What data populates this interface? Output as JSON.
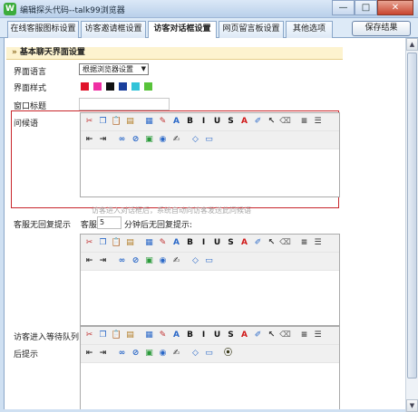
{
  "window": {
    "title": "编辑探头代码--talk99浏览器",
    "minimize": "—",
    "maximize": "□",
    "close": "✕"
  },
  "tabs": [
    {
      "label": "在线客服图标设置"
    },
    {
      "label": "访客邀请框设置"
    },
    {
      "label": "访客对话框设置",
      "active": true
    },
    {
      "label": "网页留言板设置"
    },
    {
      "label": "其他选项"
    }
  ],
  "save_label": "保存结果",
  "section": {
    "chev": "»",
    "title": "基本聊天界面设置"
  },
  "fields": {
    "language_label": "界面语言",
    "language_value": "根据浏览器设置",
    "style_label": "界面样式",
    "window_title_label": "窗口标题",
    "greeting_label": "问候语",
    "greeting_hint": "访客进入对话框后，系统自动向访客发送此问候语",
    "timeout_label": "客服无回复提示",
    "timeout_prefix": "客服",
    "timeout_value": "5",
    "timeout_suffix": "分钟后无回复提示:",
    "queue_label_1": "访客进入等待队列",
    "queue_label_2": "后提示"
  },
  "style_colors": [
    "#e0142b",
    "#ef2fa4",
    "#111111",
    "#1a3f9c",
    "#32c3d8",
    "#58c33a"
  ],
  "toolbar_row1": [
    {
      "name": "cut-icon",
      "glyph": "✂",
      "color": "#c03030"
    },
    {
      "name": "copy-icon",
      "glyph": "❐",
      "color": "#2a68c8"
    },
    {
      "name": "paste-icon",
      "glyph": "📋",
      "color": "#b07a20"
    },
    {
      "name": "paste-text-icon",
      "glyph": "▤",
      "color": "#b07a20"
    },
    {
      "name": "sep",
      "glyph": "",
      "color": "#000"
    },
    {
      "name": "paste-word-icon",
      "glyph": "▦",
      "color": "#2a68c8"
    },
    {
      "name": "format-icon",
      "glyph": "✎",
      "color": "#c03030"
    },
    {
      "name": "font-icon",
      "glyph": "A",
      "color": "#2a68c8"
    },
    {
      "name": "bold-icon",
      "glyph": "B",
      "color": "#111"
    },
    {
      "name": "italic-icon",
      "glyph": "I",
      "color": "#111"
    },
    {
      "name": "underline-icon",
      "glyph": "U",
      "color": "#111"
    },
    {
      "name": "strike-icon",
      "glyph": "S",
      "color": "#111"
    },
    {
      "name": "font-color-icon",
      "glyph": "A",
      "color": "#d01818"
    },
    {
      "name": "highlight-icon",
      "glyph": "✐",
      "color": "#2a68c8"
    },
    {
      "name": "select-icon",
      "glyph": "↖",
      "color": "#333"
    },
    {
      "name": "eraser-icon",
      "glyph": "⌫",
      "color": "#777"
    },
    {
      "name": "sep",
      "glyph": "",
      "color": "#000"
    },
    {
      "name": "align-icon",
      "glyph": "≡",
      "color": "#333"
    },
    {
      "name": "list-icon",
      "glyph": "☰",
      "color": "#333"
    }
  ],
  "toolbar_row2": [
    {
      "name": "outdent-icon",
      "glyph": "⇤",
      "color": "#333"
    },
    {
      "name": "indent-icon",
      "glyph": "⇥",
      "color": "#333"
    },
    {
      "name": "sep",
      "glyph": "",
      "color": "#000"
    },
    {
      "name": "link-icon",
      "glyph": "∞",
      "color": "#2a68c8"
    },
    {
      "name": "unlink-icon",
      "glyph": "⊘",
      "color": "#2a68c8"
    },
    {
      "name": "image-icon",
      "glyph": "▣",
      "color": "#2a9a3a"
    },
    {
      "name": "flash-icon",
      "glyph": "◉",
      "color": "#2a68c8"
    },
    {
      "name": "edit-icon",
      "glyph": "✍",
      "color": "#333"
    },
    {
      "name": "sep",
      "glyph": "",
      "color": "#000"
    },
    {
      "name": "source-icon",
      "glyph": "◇",
      "color": "#2a68c8"
    },
    {
      "name": "preview-icon",
      "glyph": "▭",
      "color": "#2a68c8"
    }
  ],
  "toolbar_row2_queue": [
    {
      "name": "outdent-icon",
      "glyph": "⇤",
      "color": "#333"
    },
    {
      "name": "indent-icon",
      "glyph": "⇥",
      "color": "#333"
    },
    {
      "name": "sep",
      "glyph": "",
      "color": "#000"
    },
    {
      "name": "link-icon",
      "glyph": "∞",
      "color": "#2a68c8"
    },
    {
      "name": "unlink-icon",
      "glyph": "⊘",
      "color": "#2a68c8"
    },
    {
      "name": "image-icon",
      "glyph": "▣",
      "color": "#2a9a3a"
    },
    {
      "name": "flash-icon",
      "glyph": "◉",
      "color": "#2a68c8"
    },
    {
      "name": "edit-icon",
      "glyph": "✍",
      "color": "#333"
    },
    {
      "name": "sep",
      "glyph": "",
      "color": "#000"
    },
    {
      "name": "source-icon",
      "glyph": "◇",
      "color": "#2a68c8"
    },
    {
      "name": "preview-icon",
      "glyph": "▭",
      "color": "#2a68c8"
    },
    {
      "name": "sep",
      "glyph": "",
      "color": "#000"
    },
    {
      "name": "traffic-light-icon",
      "glyph": "⦿",
      "color": "#3a3a1a"
    }
  ],
  "scrollbar": {
    "up": "▲",
    "down": "▼"
  }
}
